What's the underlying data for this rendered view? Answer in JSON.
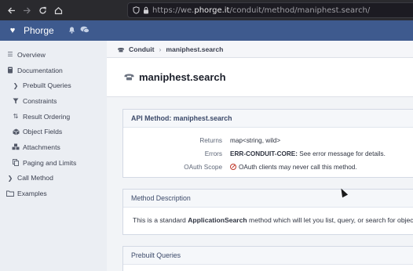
{
  "browser": {
    "url_prefix": "https://we.",
    "url_domain": "phorge.it",
    "url_path": "/conduit/method/maniphest.search/"
  },
  "app": {
    "name": "Phorge"
  },
  "sidebar": {
    "items": [
      {
        "label": "Overview",
        "icon": "list-icon"
      },
      {
        "label": "Documentation",
        "icon": "book-icon"
      },
      {
        "label": "Prebuilt Queries",
        "icon": "chevron-right-icon"
      },
      {
        "label": "Constraints",
        "icon": "filter-icon"
      },
      {
        "label": "Result Ordering",
        "icon": "sort-icon"
      },
      {
        "label": "Object Fields",
        "icon": "cube-icon"
      },
      {
        "label": "Attachments",
        "icon": "cubes-icon"
      },
      {
        "label": "Paging and Limits",
        "icon": "copy-icon"
      },
      {
        "label": "Call Method",
        "icon": "chevron-right-icon"
      },
      {
        "label": "Examples",
        "icon": "folder-icon"
      }
    ]
  },
  "breadcrumb": {
    "root": "Conduit",
    "current": "maniphest.search"
  },
  "page": {
    "title": "maniphest.search"
  },
  "api_box": {
    "heading": "API Method: maniphest.search",
    "returns_label": "Returns",
    "returns_value": "map<string, wild>",
    "errors_label": "Errors",
    "errors_code": "ERR-CONDUIT-CORE:",
    "errors_text": " See error message for details.",
    "oauth_label": "OAuth Scope",
    "oauth_text": "OAuth clients may never call this method."
  },
  "desc_box": {
    "heading": "Method Description",
    "text_before": "This is a standard ",
    "text_bold": "ApplicationSearch",
    "text_after": " method which will let you list, query, or search for objects. For"
  },
  "prebuilt_box": {
    "heading": "Prebuilt Queries"
  },
  "colors": {
    "header": "#3e5a8e",
    "sidebar": "#ebeef3",
    "browser": "#2a2a2e"
  }
}
